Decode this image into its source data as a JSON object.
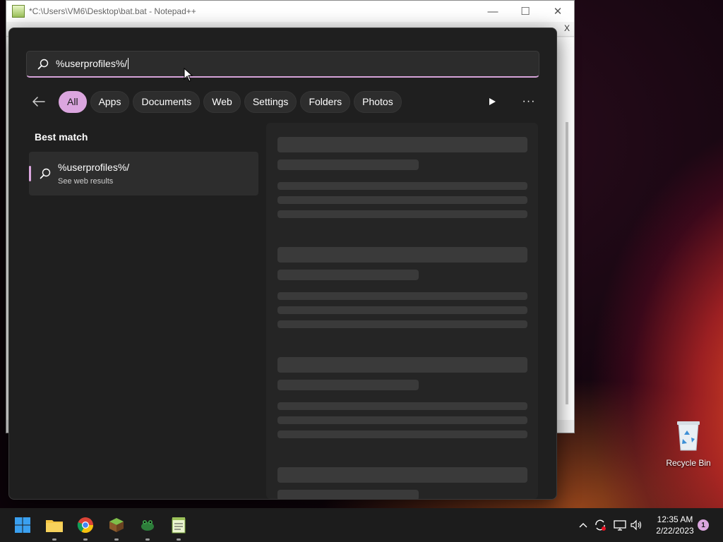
{
  "notepad": {
    "title": "*C:\\Users\\VM6\\Desktop\\bat.bat - Notepad++",
    "close_tab": "X",
    "minimize": "—",
    "maximize": "☐",
    "close": "✕"
  },
  "search": {
    "query": "%userprofiles%/"
  },
  "filters": {
    "items": [
      "All",
      "Apps",
      "Documents",
      "Web",
      "Settings",
      "Folders",
      "Photos"
    ],
    "active": "All",
    "more": "···"
  },
  "best_match": {
    "heading": "Best match",
    "title": "%userprofiles%/",
    "subtitle": "See web results"
  },
  "desktop": {
    "recycle_bin_label": "Recycle Bin"
  },
  "taskbar": {
    "apps": [
      "start-icon",
      "file-explorer-icon",
      "chrome-icon",
      "minecraft-icon",
      "app-frog-icon",
      "notepad-plus-plus-icon"
    ],
    "time": "12:35 AM",
    "date": "2/22/2023",
    "notification_count": "1"
  },
  "colors": {
    "accent": "#dba6df",
    "flyout_bg": "#1f1f1f",
    "taskbar_bg": "#1c1c1c"
  }
}
